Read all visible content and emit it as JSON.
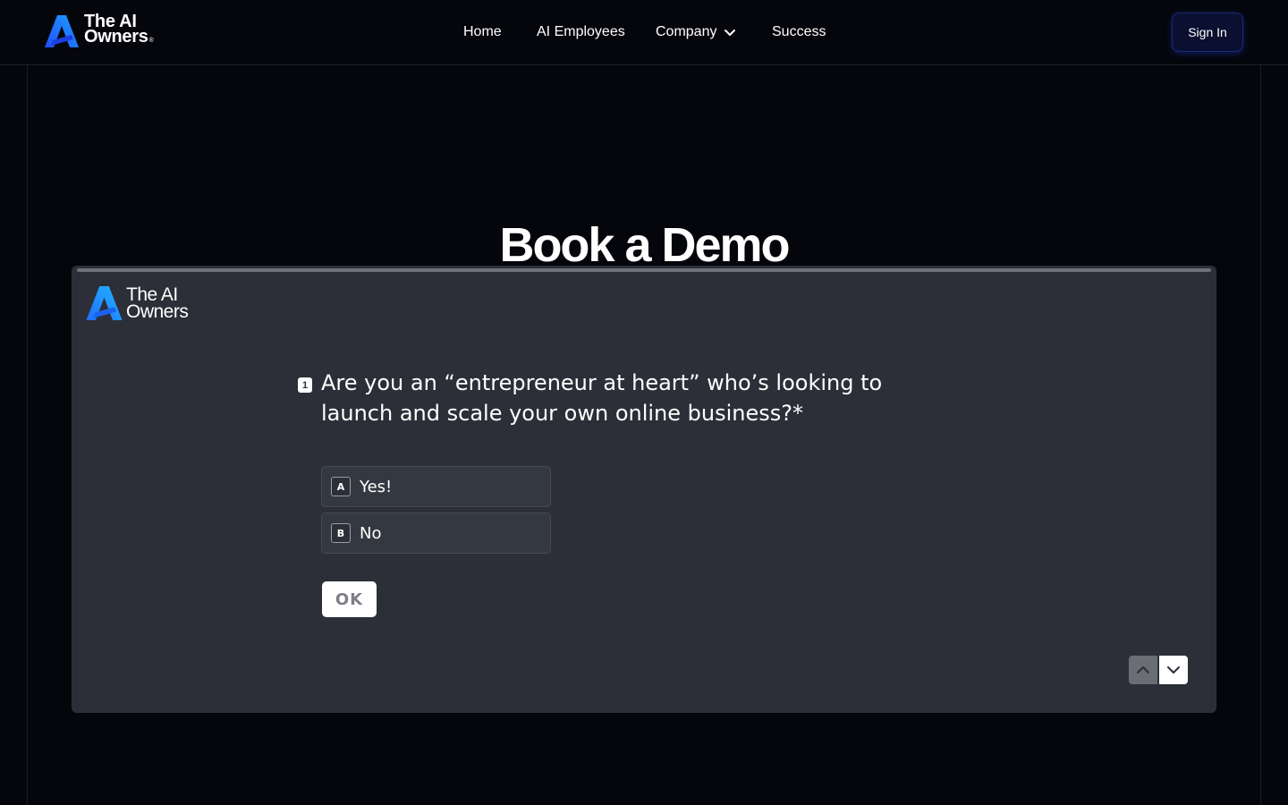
{
  "header": {
    "logo": {
      "line1": "The AI",
      "line2": "Owners",
      "mark": "®"
    },
    "nav": [
      {
        "label": "Home"
      },
      {
        "label": "AI Employees"
      },
      {
        "label": "Company"
      },
      {
        "label": "Success"
      }
    ],
    "sign_in_label": "Sign In"
  },
  "page": {
    "title": "Book a Demo"
  },
  "form": {
    "logo": {
      "line1": "The AI",
      "line2": "Owners"
    },
    "question": {
      "number": "1",
      "text": "Are you an “entrepreneur at heart” who’s looking to launch and scale your own online business?*"
    },
    "choices": [
      {
        "key": "A",
        "label": "Yes!"
      },
      {
        "key": "B",
        "label": "No"
      }
    ],
    "ok_label": "OK"
  },
  "colors": {
    "background": "#05060b",
    "card": "#2c2f38",
    "accent_blue": "#1e6bff",
    "sign_in_bg": "#0b1030"
  },
  "icons": [
    "logo-icon",
    "chevron-down-icon",
    "chevron-up-icon"
  ]
}
